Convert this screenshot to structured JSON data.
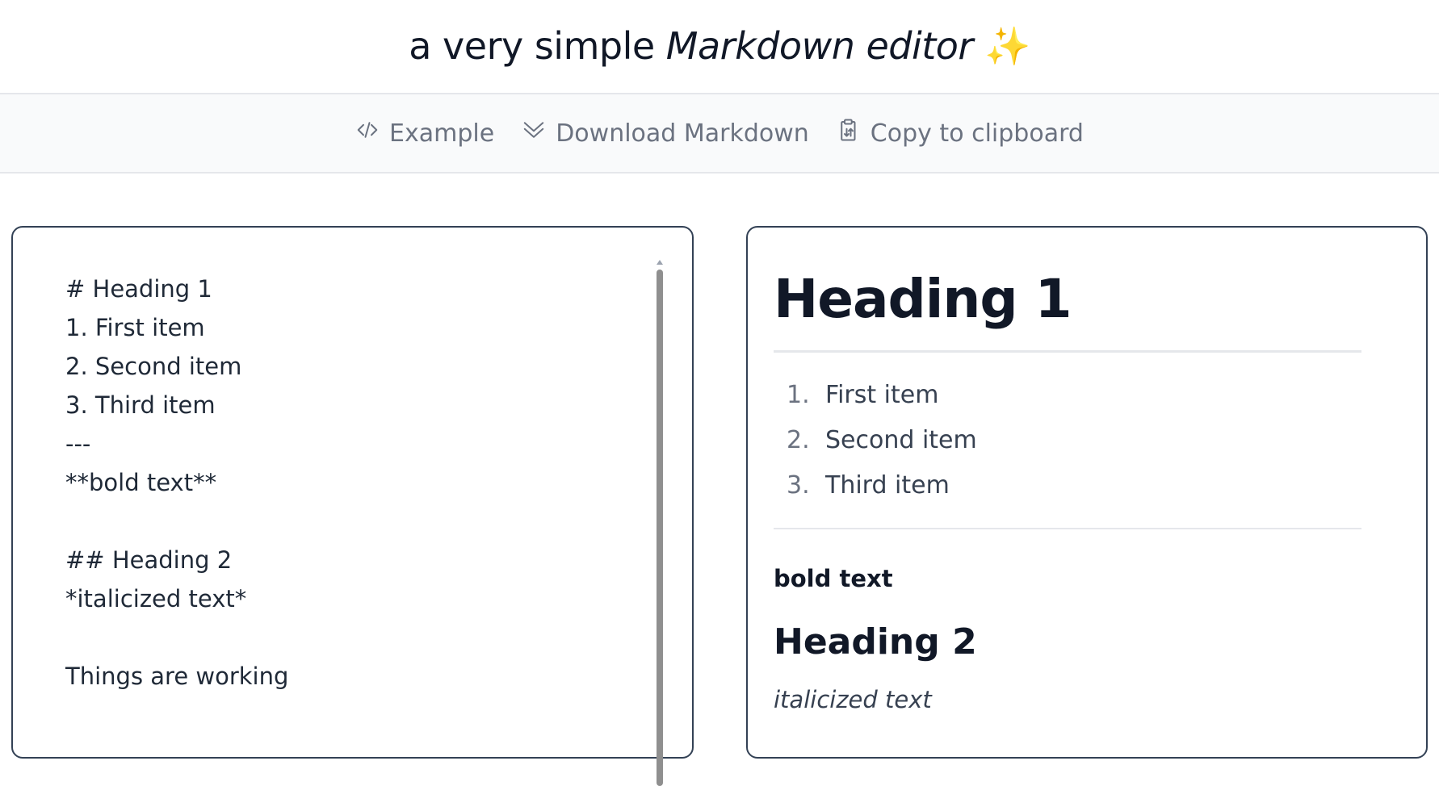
{
  "header": {
    "title_plain": "a very simple ",
    "title_italic": "Markdown editor",
    "title_emoji": "✨"
  },
  "toolbar": {
    "example_label": "Example",
    "example_icon": "code-icon",
    "download_label": "Download Markdown",
    "download_icon": "chevrons-down-icon",
    "copy_label": "Copy to clipboard",
    "copy_icon": "clipboard-icon"
  },
  "editor": {
    "content": "# Heading 1\n1. First item\n2. Second item\n3. Third item\n---\n**bold text**\n\n## Heading 2\n*italicized text*\n\nThings are working"
  },
  "preview": {
    "h1": "Heading 1",
    "list": [
      {
        "num": "1.",
        "text": "First item"
      },
      {
        "num": "2.",
        "text": "Second item"
      },
      {
        "num": "3.",
        "text": "Third item"
      }
    ],
    "bold": "bold text",
    "h2": "Heading 2",
    "italic": "italicized text"
  },
  "colors": {
    "border": "#334155",
    "muted": "#6b7280",
    "text": "#1f2937"
  }
}
